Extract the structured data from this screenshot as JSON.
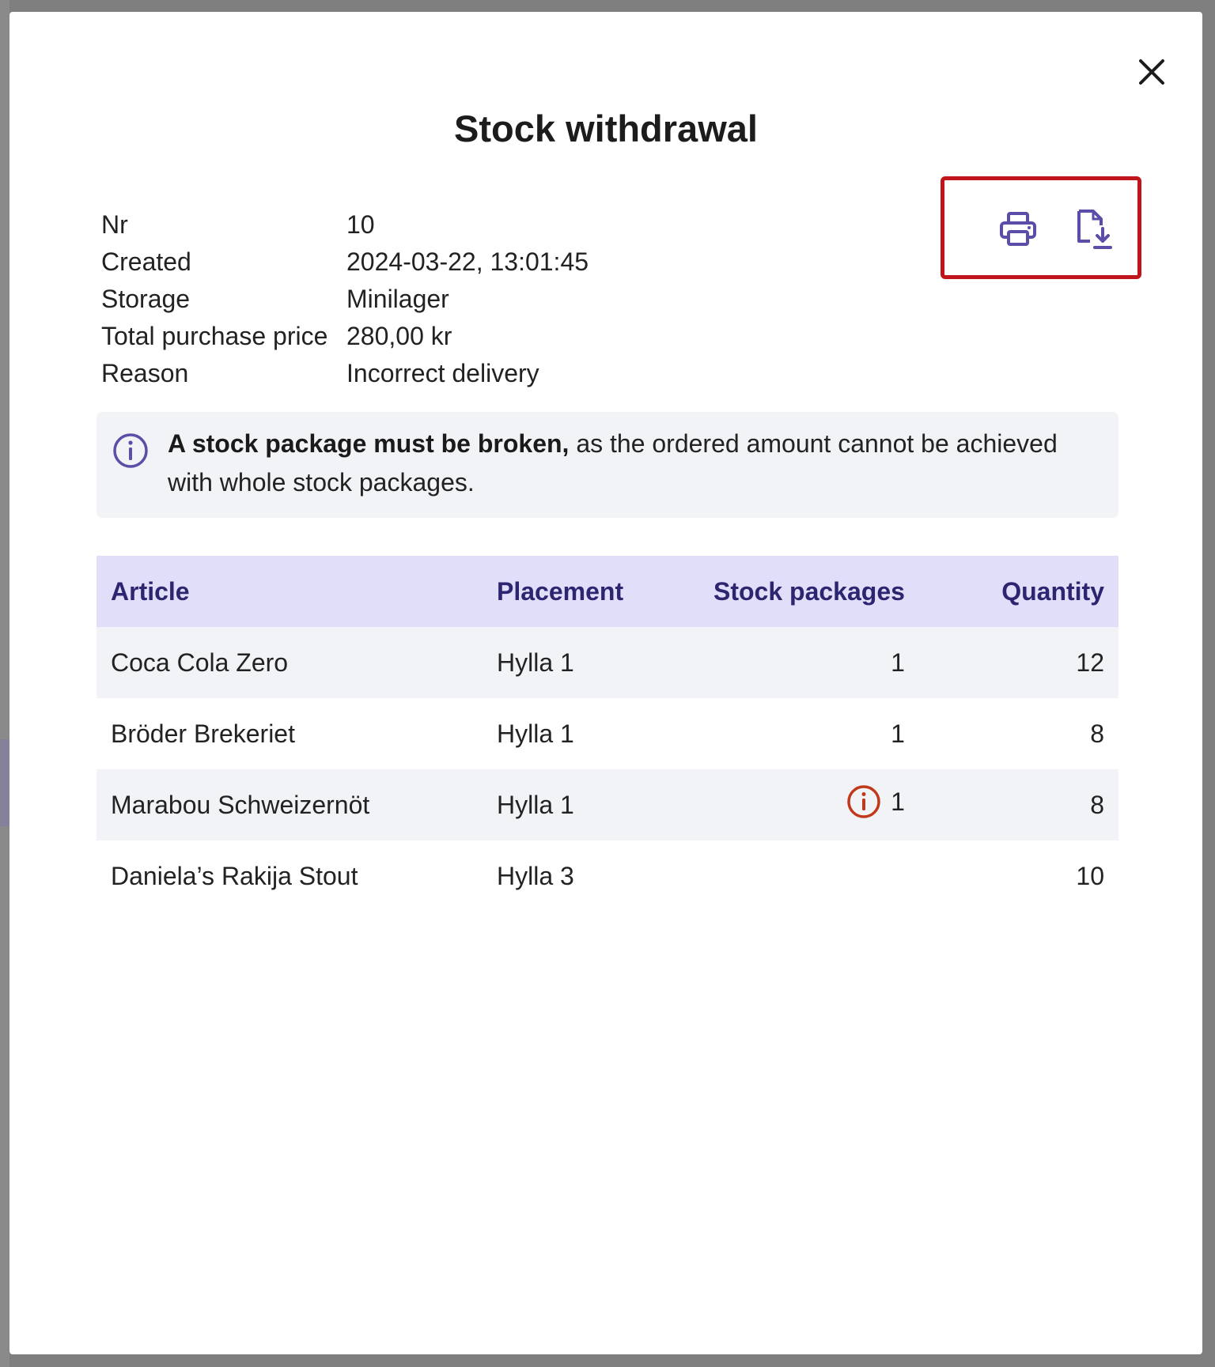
{
  "modal": {
    "title": "Stock withdrawal",
    "meta": [
      {
        "label": "Nr",
        "value": "10"
      },
      {
        "label": "Created",
        "value": "2024-03-22, 13:01:45"
      },
      {
        "label": "Storage",
        "value": "Minilager"
      },
      {
        "label": "Total purchase price",
        "value": "280,00 kr"
      },
      {
        "label": "Reason",
        "value": "Incorrect delivery"
      }
    ],
    "actions": {
      "print_icon": "printer-icon",
      "download_icon": "file-download-icon"
    },
    "notice": {
      "icon": "info-icon",
      "bold": "A stock package must be broken,",
      "text": " as the ordered amount cannot be achieved with whole stock packages."
    },
    "table": {
      "headers": [
        "Article",
        "Placement",
        "Stock packages",
        "Quantity"
      ],
      "rows": [
        {
          "article": "Coca Cola Zero",
          "placement": "Hylla 1",
          "packages": "1",
          "quantity": "12",
          "warning": false
        },
        {
          "article": "Bröder Brekeriet",
          "placement": "Hylla 1",
          "packages": "1",
          "quantity": "8",
          "warning": false
        },
        {
          "article": "Marabou Schweizernöt",
          "placement": "Hylla 1",
          "packages": "1",
          "quantity": "8",
          "warning": true
        },
        {
          "article": "Daniela’s Rakija Stout",
          "placement": "Hylla 3",
          "packages": "",
          "quantity": "10",
          "warning": false
        }
      ]
    }
  },
  "colors": {
    "accent": "#5b4ea8",
    "header_bg": "#e1defa",
    "header_text": "#2c2670",
    "highlight_border": "#c0161b",
    "warning": "#c0391b",
    "row_alt": "#f2f3f6"
  }
}
